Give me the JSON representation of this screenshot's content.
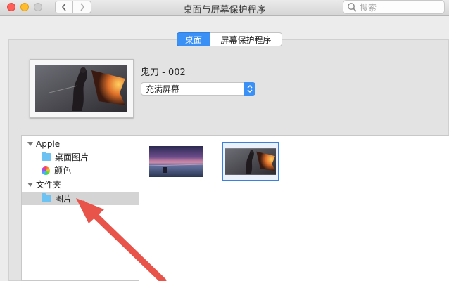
{
  "window": {
    "title": "桌面与屏幕保护程序"
  },
  "toolbar": {
    "search_placeholder": "搜索"
  },
  "tabs": [
    {
      "label": "桌面",
      "active": true
    },
    {
      "label": "屏幕保护程序",
      "active": false
    }
  ],
  "current": {
    "image_name": "鬼刀 - 002",
    "fill_mode": "充满屏幕"
  },
  "sidebar": {
    "groups": [
      {
        "label": "Apple",
        "items": [
          {
            "label": "桌面图片",
            "icon": "folder-icon"
          },
          {
            "label": "颜色",
            "icon": "color-wheel-icon"
          }
        ]
      },
      {
        "label": "文件夹",
        "items": [
          {
            "label": "图片",
            "icon": "folder-icon",
            "selected": true
          }
        ]
      }
    ]
  },
  "colors": {
    "accent": "#3b90f5",
    "arrow": "#e8534a",
    "selection_border": "#3b80e0"
  }
}
